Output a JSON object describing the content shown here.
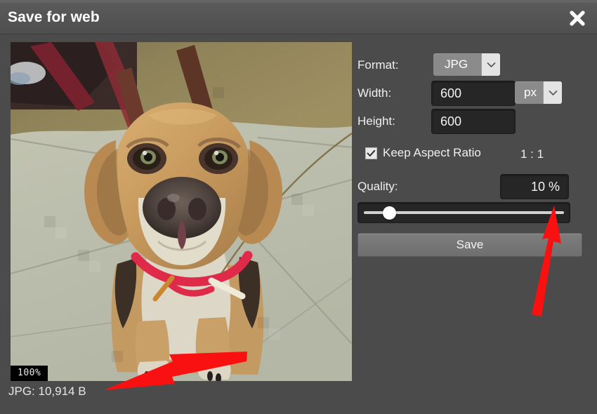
{
  "window": {
    "title": "Save for web",
    "close_icon": "close-icon"
  },
  "preview": {
    "zoom_badge": "100%",
    "filesize_label": "JPG: 10,914 B",
    "image_alt": "photo of a brown dog sitting on a tiled floor looking up at the camera"
  },
  "panel": {
    "format": {
      "label": "Format:",
      "value": "JPG",
      "arrow_icon": "chevron-down-icon"
    },
    "width": {
      "label": "Width:",
      "value": "600"
    },
    "height": {
      "label": "Height:",
      "value": "600"
    },
    "unit": {
      "value": "px",
      "arrow_icon": "chevron-down-icon"
    },
    "keep_aspect": {
      "label": "Keep Aspect Ratio",
      "checked": true,
      "check_icon": "checkmark-icon",
      "ratio": "1 : 1"
    },
    "quality": {
      "label": "Quality:",
      "value": "10 %",
      "slider_percent": 10
    },
    "save": {
      "label": "Save"
    }
  },
  "annotations": {
    "arrow_color": "#f91010",
    "arrow_quality_slider": "arrow-pointing-to-quality-slider",
    "arrow_filesize": "arrow-pointing-to-filesize"
  },
  "colors": {
    "dialog_bg": "#4b4b4b",
    "titlebar_bg": "#545454",
    "field_bg": "#262626",
    "combo_bg": "#8a8a8a",
    "text": "#efefef",
    "accent_red": "#f91010"
  }
}
